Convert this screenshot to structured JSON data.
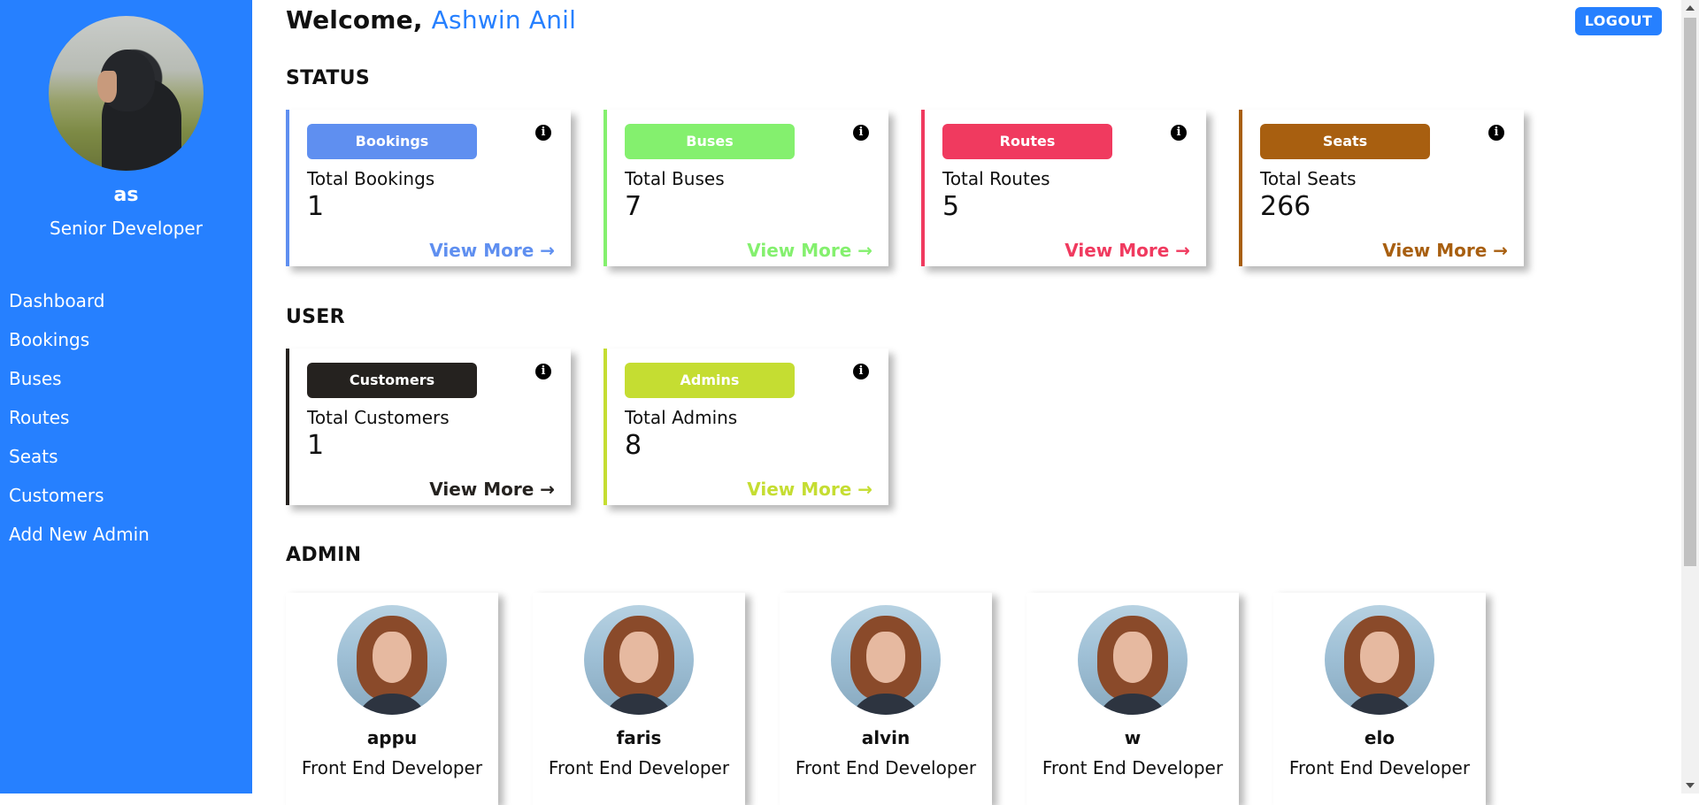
{
  "sidebar": {
    "profile_name": "as",
    "profile_role": "Senior Developer",
    "items": [
      {
        "label": "Dashboard"
      },
      {
        "label": "Bookings"
      },
      {
        "label": "Buses"
      },
      {
        "label": "Routes"
      },
      {
        "label": "Seats"
      },
      {
        "label": "Customers"
      },
      {
        "label": "Add New Admin"
      }
    ]
  },
  "header": {
    "welcome_prefix": "Welcome, ",
    "user_name": "Ashwin Anil",
    "logout_label": "LOGOUT"
  },
  "status": {
    "title": "STATUS",
    "cards": [
      {
        "badge": "Bookings",
        "label": "Total Bookings",
        "value": "1",
        "more": "View More →",
        "color": "#5f8ff0"
      },
      {
        "badge": "Buses",
        "label": "Total Buses",
        "value": "7",
        "more": "View More →",
        "color": "#84f06e"
      },
      {
        "badge": "Routes",
        "label": "Total Routes",
        "value": "5",
        "more": "View More →",
        "color": "#f03a5f"
      },
      {
        "badge": "Seats",
        "label": "Total Seats",
        "value": "266",
        "more": "View More →",
        "color": "#a85f10"
      }
    ]
  },
  "user": {
    "title": "USER",
    "cards": [
      {
        "badge": "Customers",
        "label": "Total Customers",
        "value": "1",
        "more": "View More →",
        "color": "#25221f"
      },
      {
        "badge": "Admins",
        "label": "Total Admins",
        "value": "8",
        "more": "View More →",
        "color": "#c5dd32"
      }
    ]
  },
  "admin": {
    "title": "ADMIN",
    "people": [
      {
        "name": "appu",
        "role": "Front End Developer"
      },
      {
        "name": "faris",
        "role": "Front End Developer"
      },
      {
        "name": "alvin",
        "role": "Front End Developer"
      },
      {
        "name": "w",
        "role": "Front End Developer"
      },
      {
        "name": "elo",
        "role": "Front End Developer"
      }
    ]
  },
  "icons": {
    "info": "i"
  },
  "colors": {
    "sidebar": "#2680ff",
    "accent": "#2680ff"
  }
}
